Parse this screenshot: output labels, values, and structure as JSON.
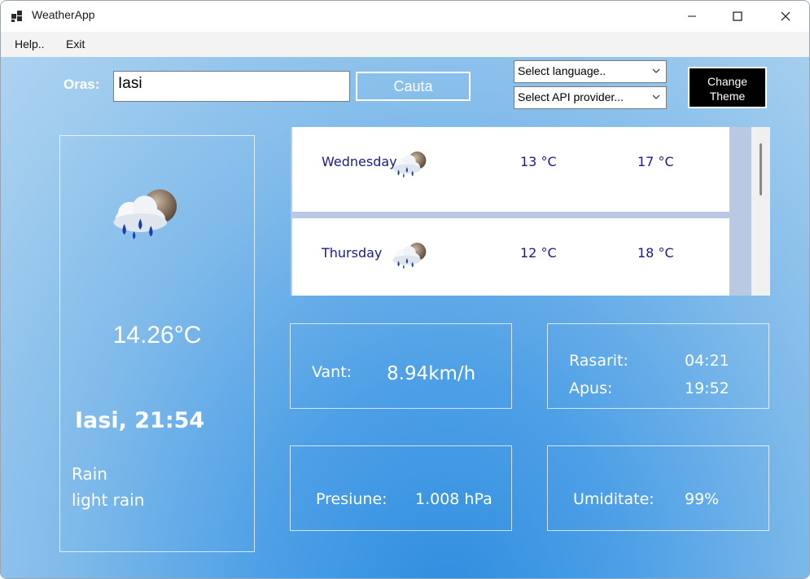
{
  "window": {
    "title": "WeatherApp"
  },
  "menu": {
    "help": "Help..",
    "exit": "Exit"
  },
  "search": {
    "label": "Oras:",
    "value": "Iasi",
    "button": "Cauta"
  },
  "selects": {
    "language": "Select language..",
    "api_provider": "Select API provider..."
  },
  "theme_button": {
    "line1": "Change",
    "line2": "Theme"
  },
  "current": {
    "icon": "rain-cloud-moon-icon",
    "temperature": "14.26°C",
    "city_time": "Iasi, 21:54",
    "main": "Rain",
    "description": "light rain"
  },
  "forecast": [
    {
      "day": "Wednesday",
      "icon": "rain-cloud-moon-icon",
      "min": "13 °C",
      "max": "17 °C"
    },
    {
      "day": "Thursday",
      "icon": "rain-cloud-moon-icon",
      "min": "12 °C",
      "max": "18 °C"
    }
  ],
  "stats": {
    "wind_label": "Vant:",
    "wind_value": "8.94km/h",
    "sunrise_label": "Rasarit:",
    "sunrise_value": "04:21",
    "sunset_label": "Apus:",
    "sunset_value": "19:52",
    "pressure_label": "Presiune:",
    "pressure_value": "1.008 hPa",
    "humidity_label": "Umiditate:",
    "humidity_value": "99%"
  },
  "colors": {
    "forecast_text": "#1a1a8c",
    "background_bottom": "#2f8ee0",
    "background_top": "#aed3f0"
  }
}
